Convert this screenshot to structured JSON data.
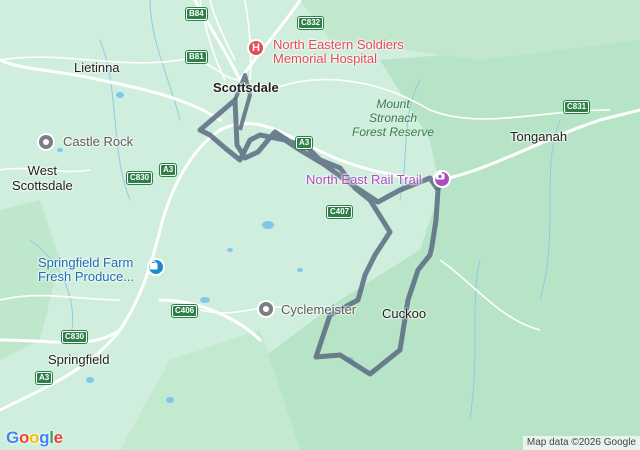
{
  "map": {
    "places": {
      "scottsdale": "Scottsdale",
      "lietinna": "Lietinna",
      "tonganah": "Tonganah",
      "west_scottsdale": "West\nScottsdale",
      "springfield": "Springfield",
      "cuckoo": "Cuckoo"
    },
    "pois": {
      "hospital": "North Eastern Soldiers\nMemorial Hospital",
      "castle_rock": "Castle Rock",
      "rail_trail": "North East Rail Trail",
      "springfield_farm": "Springfield Farm\nFresh Produce...",
      "cyclemeister": "Cyclemeister"
    },
    "forest": "Mount\nStronach\nForest Reserve",
    "road_shields": {
      "b84": "B84",
      "c832": "C832",
      "b81": "B81",
      "a3_top": "A3",
      "a3_left": "A3",
      "a3_bottom": "A3",
      "c830_top": "C830",
      "c830_bottom": "C830",
      "c831": "C831",
      "c407": "C407",
      "c406": "C406"
    },
    "icons": {
      "hospital": "hospital-icon",
      "castle_rock": "point-of-interest-icon",
      "rail_trail": "camera-icon",
      "springfield_farm": "shopping-bag-icon",
      "cyclemeister": "point-of-interest-icon"
    },
    "colors": {
      "route": "#5b6b80",
      "hospital": "#e34c56",
      "tourist": "#a84fc0",
      "shop": "#1a8bcd",
      "poi": "#7b7f85",
      "road_shield": "#2f8048"
    }
  },
  "branding": {
    "logo": "Google",
    "attribution": "Map data ©2026 Google"
  }
}
